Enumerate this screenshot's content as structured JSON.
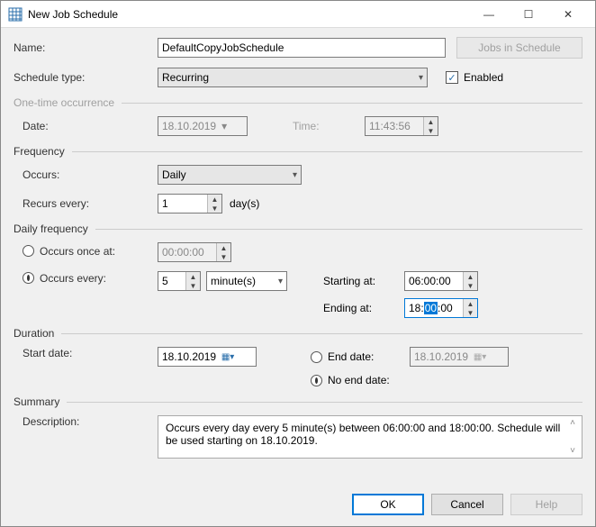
{
  "window": {
    "title": "New Job Schedule"
  },
  "labels": {
    "name": "Name:",
    "schedule_type": "Schedule type:",
    "enabled": "Enabled",
    "date": "Date:",
    "time": "Time:",
    "occurs": "Occurs:",
    "recurs_every": "Recurs every:",
    "days_unit": "day(s)",
    "occurs_once": "Occurs once at:",
    "occurs_every": "Occurs every:",
    "starting_at": "Starting at:",
    "ending_at": "Ending at:",
    "start_date": "Start date:",
    "end_date": "End date:",
    "no_end_date": "No end date:",
    "description": "Description:"
  },
  "groups": {
    "one_time": "One-time occurrence",
    "frequency": "Frequency",
    "daily_freq": "Daily frequency",
    "duration": "Duration",
    "summary": "Summary"
  },
  "buttons": {
    "jobs_in_schedule": "Jobs in Schedule",
    "ok": "OK",
    "cancel": "Cancel",
    "help": "Help"
  },
  "values": {
    "name": "DefaultCopyJobSchedule",
    "schedule_type": "Recurring",
    "enabled_checked": "✓",
    "onetime_date": "18.10.2019",
    "onetime_time": "11:43:56",
    "occurs": "Daily",
    "recurs_every": "1",
    "occurs_once_time": "00:00:00",
    "occurs_every_n": "5",
    "occurs_every_unit": "minute(s)",
    "starting_at": "06:00:00",
    "ending_pre": "18:",
    "ending_sel": "00",
    "ending_post": ":00",
    "start_date": "18.10.2019",
    "end_date": "18.10.2019",
    "description": "Occurs every day every 5 minute(s) between 06:00:00 and 18:00:00. Schedule will be used starting on 18.10.2019."
  },
  "state": {
    "daily_mode": "every",
    "duration_end": "no_end"
  }
}
